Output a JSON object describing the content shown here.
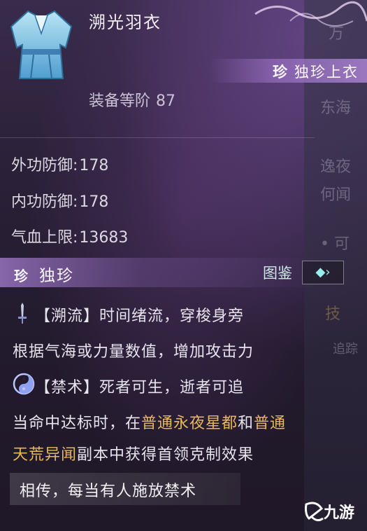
{
  "item": {
    "name": "溯光羽衣",
    "quality_badge": "珍",
    "quality_label": "独珍上衣",
    "gear_level_label": "装备等阶",
    "gear_level_value": "87"
  },
  "stats": [
    {
      "label": "外功防御:",
      "value": "178"
    },
    {
      "label": "内功防御:",
      "value": "178"
    },
    {
      "label": "气血上限:",
      "value": "13683"
    }
  ],
  "section": {
    "badge": "珍",
    "title": "独珍",
    "atlas_label": "图鉴",
    "atlas_arrow": "›"
  },
  "effects": {
    "effect1_title": "【溯流】时间绪流，穿梭身旁",
    "effect1_desc": "根据气海或力量数值，增加攻击力",
    "effect2_title": "【禁术】死者可生，逝者可追",
    "effect2_desc_a": "当命中达标时，在",
    "effect2_hl1": "普通永夜星都",
    "effect2_desc_b": "和",
    "effect2_hl2": "普通",
    "effect2_hl3": "天荒异闻",
    "effect2_desc_c": "副本中获得首领克制效果"
  },
  "lore": "相传，每当有人施放禁术",
  "side_texts": [
    "万",
    "东海",
    "逸夜",
    "何闻",
    "• 可",
    "技",
    "追踪"
  ],
  "watermark": "九游",
  "colors": {
    "highlight": "#e8b85a",
    "quality": "#a07ad0"
  }
}
